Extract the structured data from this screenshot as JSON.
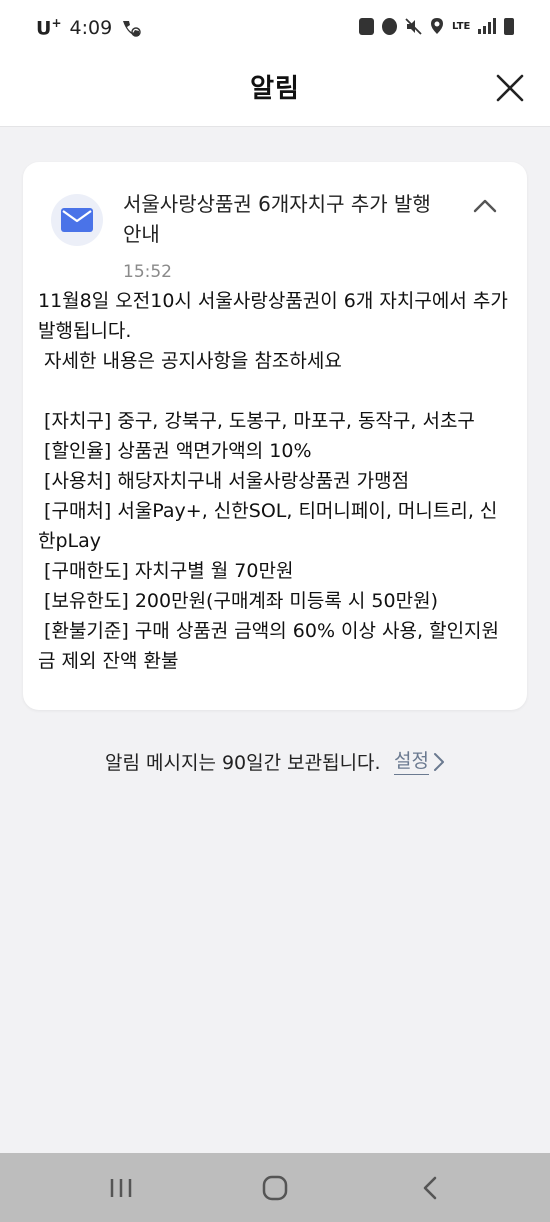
{
  "status_bar": {
    "carrier": "U",
    "carrier_sup": "+",
    "time": "4:09",
    "lte": "LTE"
  },
  "header": {
    "title": "알림"
  },
  "notification": {
    "title": "서울사랑상품권 6개자치구 추가 발행 안내",
    "time": "15:52",
    "body": [
      "11월8일 오전10시 서울사랑상품권이 6개 자치구에서 추가 발행됩니다.",
      " 자세한 내용은 공지사항을 참조하세요",
      "",
      " [자치구] 중구, 강북구, 도봉구, 마포구, 동작구, 서초구",
      " [할인율] 상품권 액면가액의 10%",
      " [사용처] 해당자치구내 서울사랑상품권 가맹점",
      " [구매처] 서울Pay+, 신한SOL, 티머니페이, 머니트리, 신한pLay",
      " [구매한도] 자치구별 월 70만원",
      " [보유한도] 200만원(구매계좌 미등록 시 50만원)",
      " [환불기준] 구매 상품권 금액의 60% 이상 사용, 할인지원금 제외 잔액 환불"
    ]
  },
  "footer": {
    "retention_text": "알림 메시지는 90일간 보관됩니다.",
    "settings_label": "설정"
  },
  "colors": {
    "background": "#f2f2f4",
    "card": "#ffffff",
    "mail_icon": "#4a73e8",
    "link": "#6b7a90",
    "nav_bar": "#bdbdbd"
  },
  "icons": {
    "close": "close-icon",
    "mail": "mail-icon",
    "collapse": "chevron-up-icon",
    "settings": "chevron-right-icon"
  }
}
